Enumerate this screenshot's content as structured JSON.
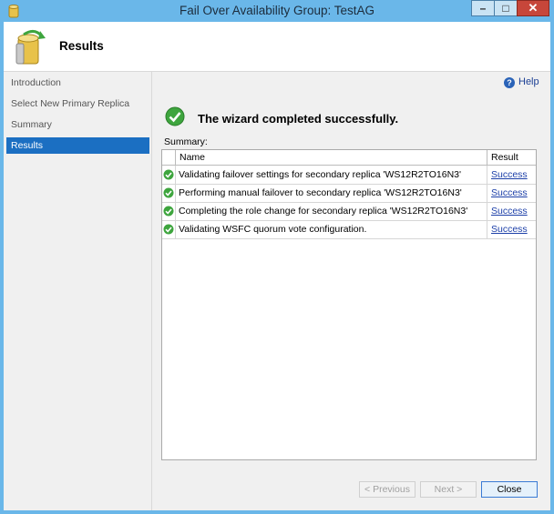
{
  "window": {
    "title": "Fail Over Availability Group: TestAG"
  },
  "header": {
    "title": "Results"
  },
  "nav": {
    "items": [
      {
        "label": "Introduction"
      },
      {
        "label": "Select New Primary Replica"
      },
      {
        "label": "Summary"
      },
      {
        "label": "Results",
        "selected": true
      }
    ]
  },
  "main": {
    "help_label": "Help",
    "completion_message": "The wizard completed successfully.",
    "summary_label": "Summary:",
    "grid": {
      "columns": [
        "Name",
        "Result"
      ],
      "rows": [
        {
          "name": "Validating failover settings for secondary replica 'WS12R2TO16N3'",
          "result": "Success"
        },
        {
          "name": "Performing manual failover to secondary replica 'WS12R2TO16N3'",
          "result": "Success"
        },
        {
          "name": "Completing the role change for secondary replica 'WS12R2TO16N3'",
          "result": "Success"
        },
        {
          "name": "Validating WSFC quorum vote configuration.",
          "result": "Success"
        }
      ]
    }
  },
  "footer": {
    "previous_label": "< Previous",
    "next_label": "Next >",
    "close_label": "Close"
  },
  "colors": {
    "titlebar": "#6ab7e9",
    "selection": "#1b6fc2",
    "success_green": "#3ea53e",
    "link": "#1c3fa8"
  }
}
